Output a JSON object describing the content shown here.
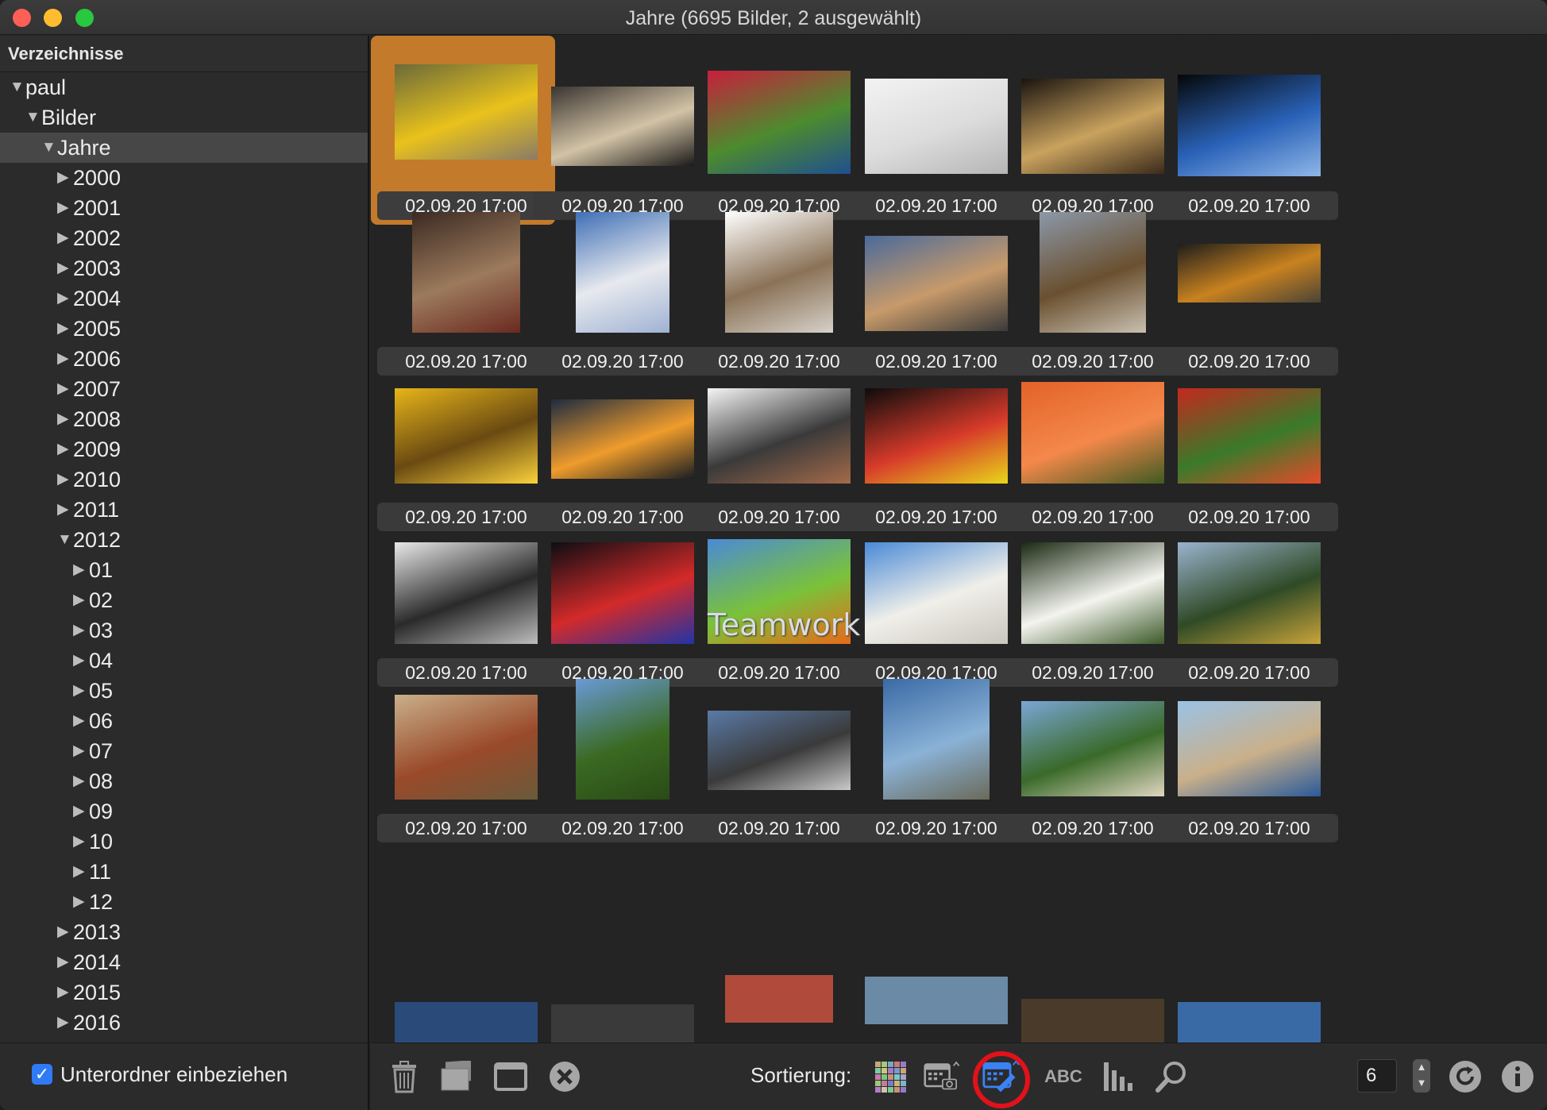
{
  "window": {
    "title": "Jahre (6695 Bilder, 2 ausgewählt)"
  },
  "sidebar": {
    "header": "Verzeichnisse",
    "tree": [
      {
        "label": "paul",
        "expanded": true,
        "level": 0
      },
      {
        "label": "Bilder",
        "expanded": true,
        "level": 1
      },
      {
        "label": "Jahre",
        "expanded": true,
        "level": 2,
        "selected": true
      },
      {
        "label": "2000",
        "expanded": false,
        "level": 3
      },
      {
        "label": "2001",
        "expanded": false,
        "level": 3
      },
      {
        "label": "2002",
        "expanded": false,
        "level": 3
      },
      {
        "label": "2003",
        "expanded": false,
        "level": 3
      },
      {
        "label": "2004",
        "expanded": false,
        "level": 3
      },
      {
        "label": "2005",
        "expanded": false,
        "level": 3
      },
      {
        "label": "2006",
        "expanded": false,
        "level": 3
      },
      {
        "label": "2007",
        "expanded": false,
        "level": 3
      },
      {
        "label": "2008",
        "expanded": false,
        "level": 3
      },
      {
        "label": "2009",
        "expanded": false,
        "level": 3
      },
      {
        "label": "2010",
        "expanded": false,
        "level": 3
      },
      {
        "label": "2011",
        "expanded": false,
        "level": 3
      },
      {
        "label": "2012",
        "expanded": true,
        "level": 3
      },
      {
        "label": "01",
        "expanded": false,
        "level": 4
      },
      {
        "label": "02",
        "expanded": false,
        "level": 4
      },
      {
        "label": "03",
        "expanded": false,
        "level": 4
      },
      {
        "label": "04",
        "expanded": false,
        "level": 4
      },
      {
        "label": "05",
        "expanded": false,
        "level": 4
      },
      {
        "label": "06",
        "expanded": false,
        "level": 4
      },
      {
        "label": "07",
        "expanded": false,
        "level": 4
      },
      {
        "label": "08",
        "expanded": false,
        "level": 4
      },
      {
        "label": "09",
        "expanded": false,
        "level": 4
      },
      {
        "label": "10",
        "expanded": false,
        "level": 4
      },
      {
        "label": "11",
        "expanded": false,
        "level": 4
      },
      {
        "label": "12",
        "expanded": false,
        "level": 4
      },
      {
        "label": "2013",
        "expanded": false,
        "level": 3
      },
      {
        "label": "2014",
        "expanded": false,
        "level": 3
      },
      {
        "label": "2015",
        "expanded": false,
        "level": 3
      },
      {
        "label": "2016",
        "expanded": false,
        "level": 3
      }
    ],
    "include_subfolders_label": "Unterordner einbeziehen",
    "include_subfolders_checked": true
  },
  "grid": {
    "columns": 6,
    "photos": [
      {
        "caption": "02.09.20 17:00",
        "subject": "sunflower-on-book",
        "selected": true,
        "colors": [
          "#6b6a3a",
          "#e9c21b",
          "#8a7b66"
        ]
      },
      {
        "caption": "02.09.20 17:00",
        "subject": "mussels",
        "colors": [
          "#3a3430",
          "#d2c3a6",
          "#1c1a18"
        ]
      },
      {
        "caption": "02.09.20 17:00",
        "subject": "radishes",
        "colors": [
          "#c71f3c",
          "#4d8b2e",
          "#1f4f8f"
        ]
      },
      {
        "caption": "02.09.20 17:00",
        "subject": "snowy-twigs",
        "colors": [
          "#f3f3f3",
          "#dcdcdc",
          "#b5b5b5"
        ]
      },
      {
        "caption": "02.09.20 17:00",
        "subject": "chess-pieces",
        "colors": [
          "#1a1410",
          "#c9a25e",
          "#3a2a1a"
        ]
      },
      {
        "caption": "02.09.20 17:00",
        "subject": "blue-smoke",
        "colors": [
          "#050708",
          "#2a62b8",
          "#8fb6e8"
        ]
      },
      {
        "caption": "02.09.20 17:00",
        "subject": "yorkshire-terrier",
        "colors": [
          "#3b2a22",
          "#9c7a5c",
          "#6a2a20"
        ]
      },
      {
        "caption": "02.09.20 17:00",
        "subject": "white-minaret",
        "colors": [
          "#3f6fb6",
          "#e7e9ee",
          "#9fb2d3"
        ]
      },
      {
        "caption": "02.09.20 17:00",
        "subject": "twine-roll",
        "colors": [
          "#ffffff",
          "#8a7257",
          "#d7d1c9"
        ]
      },
      {
        "caption": "02.09.20 17:00",
        "subject": "cat-on-wall",
        "colors": [
          "#4a6a9a",
          "#c79a6a",
          "#3a3a3a"
        ]
      },
      {
        "caption": "02.09.20 17:00",
        "subject": "wooden-door",
        "colors": [
          "#8b98a8",
          "#6a5030",
          "#c9c0b0"
        ]
      },
      {
        "caption": "02.09.20 17:00",
        "subject": "sunset-clouds",
        "colors": [
          "#1d1d1c",
          "#c9821f",
          "#4a4336"
        ]
      },
      {
        "caption": "02.09.20 17:00",
        "subject": "sunflower",
        "colors": [
          "#e7b519",
          "#6a4a12",
          "#fbd23a"
        ]
      },
      {
        "caption": "02.09.20 17:00",
        "subject": "sea-sunset",
        "colors": [
          "#1d2b40",
          "#ef9c2c",
          "#1a1e22"
        ]
      },
      {
        "caption": "02.09.20 17:00",
        "subject": "winter-branches",
        "colors": [
          "#f5f5f5",
          "#3a3a3a",
          "#a46a4a"
        ]
      },
      {
        "caption": "02.09.20 17:00",
        "subject": "colored-socks",
        "colors": [
          "#0c0c0c",
          "#d63a2a",
          "#e8d71a"
        ]
      },
      {
        "caption": "02.09.20 17:00",
        "subject": "orange-rose",
        "colors": [
          "#e3622a",
          "#f4884a",
          "#3f5a22"
        ]
      },
      {
        "caption": "02.09.20 17:00",
        "subject": "tomatoes",
        "colors": [
          "#c3281e",
          "#3a7a2a",
          "#e64a2a"
        ]
      },
      {
        "caption": "02.09.20 17:00",
        "subject": "snowy-fence",
        "colors": [
          "#e9e9e9",
          "#2a2a2a",
          "#bdbdbd"
        ]
      },
      {
        "caption": "02.09.20 17:00",
        "subject": "underground-sign",
        "colors": [
          "#0d0d12",
          "#d32a2a",
          "#2233a5"
        ]
      },
      {
        "caption": "02.09.20 17:00",
        "subject": "teamwork-figures",
        "colors": [
          "#4a8ad6",
          "#7ac23a",
          "#e86a1a"
        ],
        "overlay_text": "Teamwork"
      },
      {
        "caption": "02.09.20 17:00",
        "subject": "white-hotel",
        "colors": [
          "#4a8ad6",
          "#f0efe9",
          "#c9c6bd"
        ]
      },
      {
        "caption": "02.09.20 17:00",
        "subject": "white-rose",
        "colors": [
          "#1a2a12",
          "#f4f4ef",
          "#3d5a2a"
        ]
      },
      {
        "caption": "02.09.20 17:00",
        "subject": "golden-pavilion",
        "colors": [
          "#9ab3cf",
          "#2f4a26",
          "#c9a43a"
        ]
      },
      {
        "caption": "02.09.20 17:00",
        "subject": "lichen-texture",
        "colors": [
          "#c9b08a",
          "#9a4a2a",
          "#6a5a3a"
        ]
      },
      {
        "caption": "02.09.20 17:00",
        "subject": "oak-tree",
        "colors": [
          "#6a9ad6",
          "#3a6a22",
          "#2a4a16"
        ]
      },
      {
        "caption": "02.09.20 17:00",
        "subject": "rainy-promenade",
        "colors": [
          "#5a7aa6",
          "#3a3a3a",
          "#c9c9c9"
        ]
      },
      {
        "caption": "02.09.20 17:00",
        "subject": "sea-cliff",
        "colors": [
          "#3a6aa6",
          "#8ab2d6",
          "#6a6a5a"
        ]
      },
      {
        "caption": "02.09.20 17:00",
        "subject": "palm-villa",
        "colors": [
          "#7aa6d6",
          "#3a6a2a",
          "#e0d6c0"
        ]
      },
      {
        "caption": "02.09.20 17:00",
        "subject": "beach-shore",
        "colors": [
          "#9ac2e6",
          "#c9b08a",
          "#2a5a9a"
        ]
      }
    ]
  },
  "toolbar": {
    "sort_label": "Sortierung:",
    "abc_label": "ABC",
    "column_count": "6",
    "icons": [
      "trash-icon",
      "slideshow-icon",
      "fullscreen-icon",
      "close-circle-icon",
      "sort-color-grid-icon",
      "sort-date-taken-icon",
      "sort-date-modified-icon",
      "sort-name-icon",
      "sort-size-icon",
      "search-icon",
      "refresh-icon",
      "info-icon"
    ]
  },
  "colors": {
    "selection_orange": "#c37a2b",
    "checkbox_blue": "#2f7bf5",
    "highlight_ring": "#e2111a",
    "sort_active_blue": "#3b82f6"
  }
}
